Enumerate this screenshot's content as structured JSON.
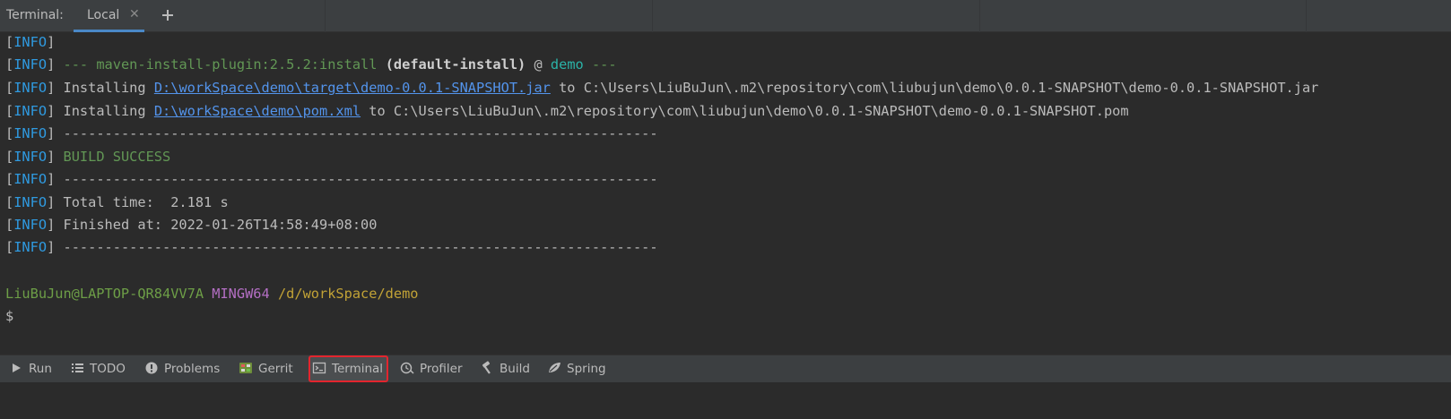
{
  "tabbar": {
    "prefix": "Terminal:",
    "tab_label": "Local",
    "close_glyph": "✕"
  },
  "terminal": {
    "info_tag": "INFO",
    "plugin_sep_start": "---",
    "plugin_name": "maven-install-plugin:2.5.2:install",
    "plugin_goal": "(default-install)",
    "plugin_at": "@",
    "plugin_project": "demo",
    "plugin_sep_end": "---",
    "installing": "Installing",
    "to": "to",
    "jar_link": "D:\\workSpace\\demo\\target\\demo-0.0.1-SNAPSHOT.jar",
    "jar_dest": "C:\\Users\\LiuBuJun\\.m2\\repository\\com\\liubujun\\demo\\0.0.1-SNAPSHOT\\demo-0.0.1-SNAPSHOT.jar",
    "pom_link": "D:\\workSpace\\demo\\pom.xml",
    "pom_dest": "C:\\Users\\LiuBuJun\\.m2\\repository\\com\\liubujun\\demo\\0.0.1-SNAPSHOT\\demo-0.0.1-SNAPSHOT.pom",
    "separator": "------------------------------------------------------------------------",
    "build_status": "BUILD SUCCESS",
    "total_time": "Total time:  2.181 s",
    "finished_at": "Finished at: 2022-01-26T14:58:49+08:00",
    "prompt_user": "LiuBuJun@LAPTOP-QR84VV7A",
    "prompt_env": "MINGW64",
    "prompt_path": "/d/workSpace/demo",
    "prompt_symbol": "$"
  },
  "toolbar": {
    "items": [
      {
        "label": "Run",
        "icon": "play-icon"
      },
      {
        "label": "TODO",
        "icon": "list-icon"
      },
      {
        "label": "Problems",
        "icon": "info-icon"
      },
      {
        "label": "Gerrit",
        "icon": "gerrit-icon"
      },
      {
        "label": "Terminal",
        "icon": "terminal-icon"
      },
      {
        "label": "Profiler",
        "icon": "profiler-icon"
      },
      {
        "label": "Build",
        "icon": "hammer-icon"
      },
      {
        "label": "Spring",
        "icon": "spring-leaf-icon"
      }
    ]
  },
  "colors": {
    "background": "#2b2b2b",
    "info": "#2f9ae0",
    "success": "#629755",
    "link": "#5394ec",
    "highlight_border": "#e3252e"
  }
}
